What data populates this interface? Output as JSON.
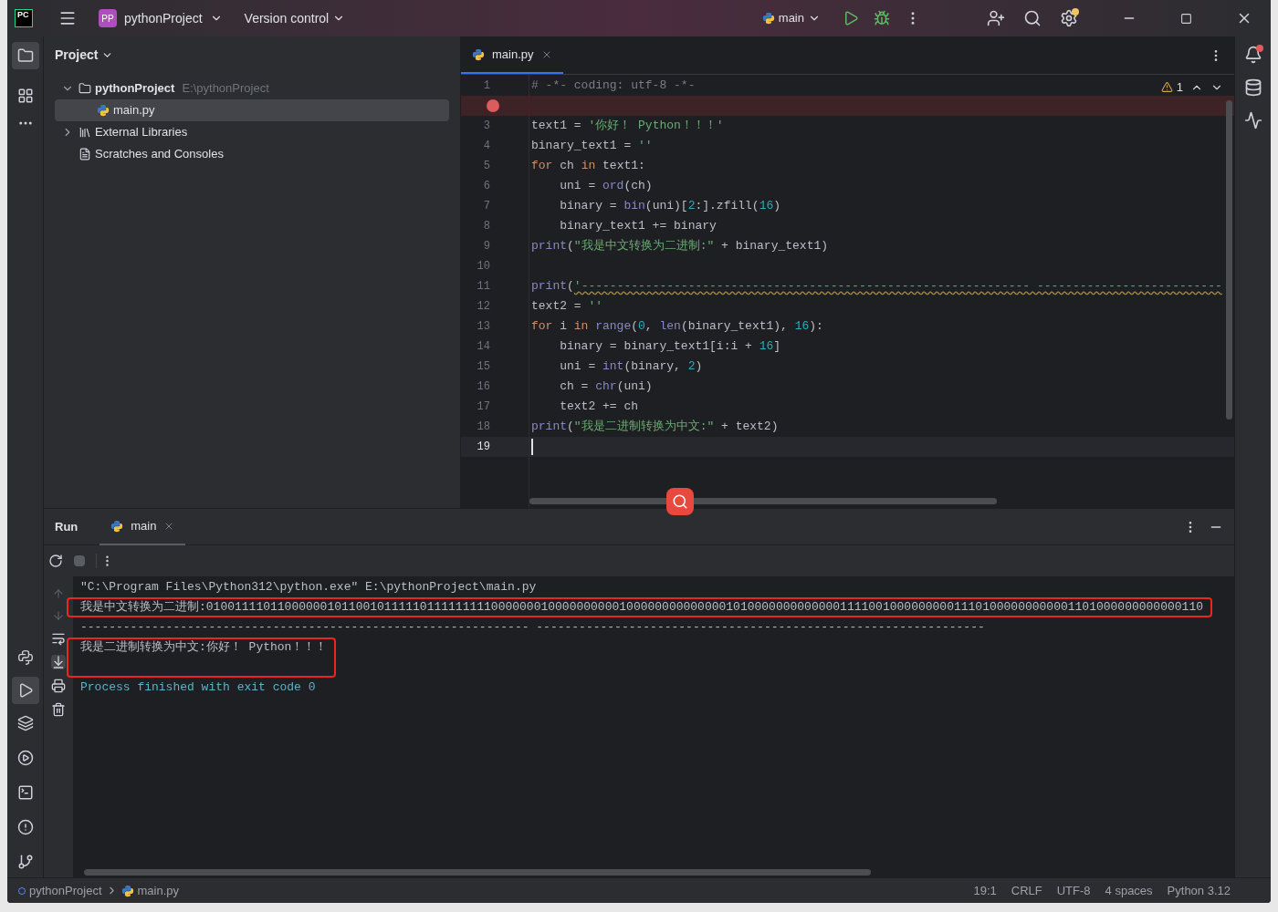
{
  "title_bar": {
    "logo": "PC",
    "project": {
      "initials": "PP",
      "name": "pythonProject"
    },
    "vcs": "Version control",
    "run_config": "main"
  },
  "project_panel": {
    "title": "Project",
    "tree": [
      {
        "label": "pythonProject",
        "path": "E:\\pythonProject",
        "kind": "folder",
        "expanded": true,
        "selected": false,
        "children": [
          {
            "label": "main.py",
            "kind": "python",
            "selected": true
          }
        ]
      },
      {
        "label": "External Libraries",
        "kind": "library",
        "expanded": false,
        "selected": false
      },
      {
        "label": "Scratches and Consoles",
        "kind": "scratches",
        "selected": false
      }
    ]
  },
  "editor": {
    "tabs": [
      {
        "label": "main.py",
        "selected": true
      }
    ],
    "warnings": "1",
    "lines": [
      {
        "number": "1",
        "tokens": [
          {
            "kind": "comment",
            "text": "# -*- coding: utf-8 -*-"
          }
        ]
      },
      {
        "breakpoint": true
      },
      {
        "number": "3",
        "tokens": [
          {
            "kind": "plain",
            "text": "text1 = "
          },
          {
            "kind": "string",
            "text": "'你好！ Python！！！'"
          }
        ]
      },
      {
        "number": "4",
        "tokens": [
          {
            "kind": "plain",
            "text": "binary_text1 = "
          },
          {
            "kind": "string",
            "text": "''"
          }
        ]
      },
      {
        "number": "5",
        "tokens": [
          {
            "kind": "keyword",
            "text": "for"
          },
          {
            "kind": "plain",
            "text": " ch "
          },
          {
            "kind": "keyword",
            "text": "in"
          },
          {
            "kind": "plain",
            "text": " text1:"
          }
        ]
      },
      {
        "number": "6",
        "tokens": [
          {
            "kind": "plain",
            "text": "    uni = "
          },
          {
            "kind": "builtin",
            "text": "ord"
          },
          {
            "kind": "plain",
            "text": "(ch)"
          }
        ]
      },
      {
        "number": "7",
        "tokens": [
          {
            "kind": "plain",
            "text": "    binary = "
          },
          {
            "kind": "builtin",
            "text": "bin"
          },
          {
            "kind": "plain",
            "text": "(uni)["
          },
          {
            "kind": "number",
            "text": "2"
          },
          {
            "kind": "plain",
            "text": ":].zfill("
          },
          {
            "kind": "number",
            "text": "16"
          },
          {
            "kind": "plain",
            "text": ")"
          }
        ]
      },
      {
        "number": "8",
        "tokens": [
          {
            "kind": "plain",
            "text": "    binary_text1 += binary"
          }
        ]
      },
      {
        "number": "9",
        "tokens": [
          {
            "kind": "builtin",
            "text": "print"
          },
          {
            "kind": "plain",
            "text": "("
          },
          {
            "kind": "string",
            "text": "\"我是中文转换为二进制:\""
          },
          {
            "kind": "plain",
            "text": " + binary_text1)"
          }
        ]
      },
      {
        "number": "10"
      },
      {
        "number": "11",
        "warning": true,
        "tokens": [
          {
            "kind": "builtin",
            "text": "print"
          },
          {
            "kind": "plain",
            "text": "("
          },
          {
            "kind": "string",
            "text": "'--------------------------------------------------------------- --------------------------"
          }
        ]
      },
      {
        "number": "12",
        "tokens": [
          {
            "kind": "plain",
            "text": "text2 = "
          },
          {
            "kind": "string",
            "text": "''"
          }
        ]
      },
      {
        "number": "13",
        "tokens": [
          {
            "kind": "keyword",
            "text": "for"
          },
          {
            "kind": "plain",
            "text": " i "
          },
          {
            "kind": "keyword",
            "text": "in "
          },
          {
            "kind": "builtin",
            "text": "range"
          },
          {
            "kind": "plain",
            "text": "("
          },
          {
            "kind": "number",
            "text": "0"
          },
          {
            "kind": "plain",
            "text": ", "
          },
          {
            "kind": "builtin",
            "text": "len"
          },
          {
            "kind": "plain",
            "text": "(binary_text1), "
          },
          {
            "kind": "number",
            "text": "16"
          },
          {
            "kind": "plain",
            "text": "):"
          }
        ]
      },
      {
        "number": "14",
        "tokens": [
          {
            "kind": "plain",
            "text": "    binary = binary_text1[i:i + "
          },
          {
            "kind": "number",
            "text": "16"
          },
          {
            "kind": "plain",
            "text": "]"
          }
        ]
      },
      {
        "number": "15",
        "tokens": [
          {
            "kind": "plain",
            "text": "    uni = "
          },
          {
            "kind": "builtin",
            "text": "int"
          },
          {
            "kind": "plain",
            "text": "(binary, "
          },
          {
            "kind": "number",
            "text": "2"
          },
          {
            "kind": "plain",
            "text": ")"
          }
        ]
      },
      {
        "number": "16",
        "tokens": [
          {
            "kind": "plain",
            "text": "    ch = "
          },
          {
            "kind": "builtin",
            "text": "chr"
          },
          {
            "kind": "plain",
            "text": "(uni)"
          }
        ]
      },
      {
        "number": "17",
        "tokens": [
          {
            "kind": "plain",
            "text": "    text2 += ch"
          }
        ]
      },
      {
        "number": "18",
        "tokens": [
          {
            "kind": "builtin",
            "text": "print"
          },
          {
            "kind": "plain",
            "text": "("
          },
          {
            "kind": "string",
            "text": "\"我是二进制转换为中文:\""
          },
          {
            "kind": "plain",
            "text": " + text2)"
          }
        ]
      },
      {
        "number": "19",
        "current": true
      }
    ]
  },
  "run_panel": {
    "title": "Run",
    "tabs": [
      {
        "label": "main",
        "selected": true
      }
    ],
    "output": [
      {
        "kind": "command",
        "boxed": false,
        "text": "\"C:\\Program Files\\Python312\\python.exe\" E:\\pythonProject\\main.py"
      },
      {
        "kind": "stdout",
        "boxed": true,
        "text": "我是中文转换为二进制:01001111011000000101100101111101111111110000000100000000001000000000000001010000000000000111100100000000011101000000000001101000000000000110"
      },
      {
        "kind": "stdout",
        "boxed": false,
        "text": "--------------------------------------------------------------- ---------------------------------------------------------------"
      },
      {
        "kind": "stdout",
        "boxed": true,
        "text": "我是二进制转换为中文:你好！ Python！！！"
      },
      {
        "kind": "exit",
        "boxed": false,
        "text": "Process finished with exit code 0"
      }
    ]
  },
  "status_bar": {
    "breadcrumbs": [
      "pythonProject",
      "main.py"
    ],
    "items": [
      "19:1",
      "CRLF",
      "UTF-8",
      "4 spaces",
      "Python 3.12"
    ]
  }
}
